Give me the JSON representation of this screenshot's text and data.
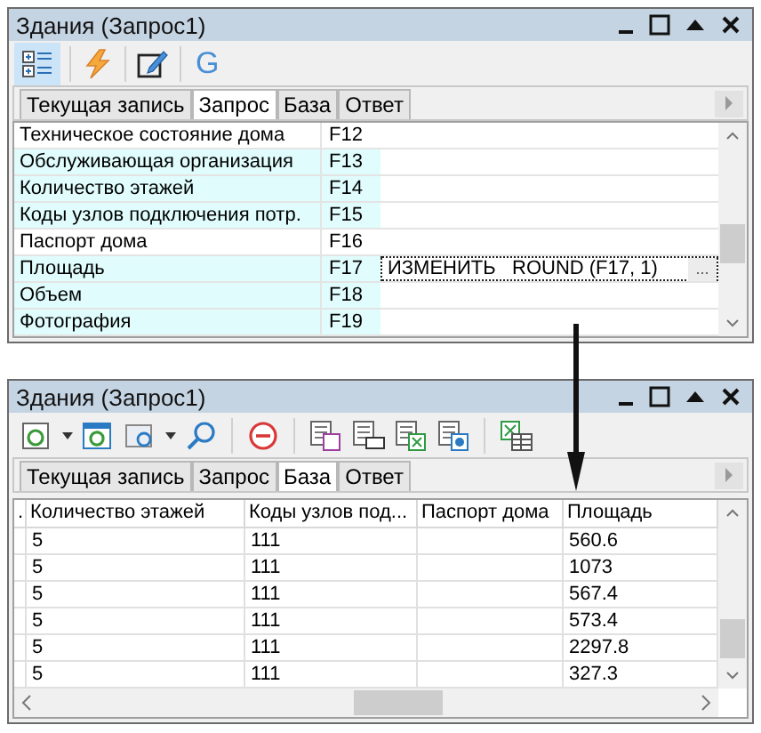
{
  "windows": [
    {
      "title": "Здания (Запрос1)",
      "toolbar": {
        "letter": "G"
      },
      "tabs": [
        {
          "label": "Текущая запись",
          "selected": false
        },
        {
          "label": "Запрос",
          "selected": true
        },
        {
          "label": "База",
          "selected": false
        },
        {
          "label": "Ответ",
          "selected": false
        }
      ],
      "query_rows": [
        {
          "name": "Техническое состояние дома",
          "field": "F12",
          "highlighted": false,
          "editing": false
        },
        {
          "name": "Обслуживающая организация",
          "field": "F13",
          "highlighted": true,
          "editing": false
        },
        {
          "name": "Количество этажей",
          "field": "F14",
          "highlighted": true,
          "editing": false
        },
        {
          "name": "Коды узлов подключения потр.",
          "field": "F15",
          "highlighted": true,
          "editing": false
        },
        {
          "name": "Паспорт дома",
          "field": "F16",
          "highlighted": false,
          "editing": false
        },
        {
          "name": "Площадь",
          "field": "F17",
          "highlighted": true,
          "editing": true,
          "value": "ИЗМЕНИТЬ   ROUND (F17, 1)",
          "button": "..."
        },
        {
          "name": "Объем",
          "field": "F18",
          "highlighted": true,
          "editing": false
        },
        {
          "name": "Фотография",
          "field": "F19",
          "highlighted": true,
          "editing": false
        }
      ]
    },
    {
      "title": "Здания (Запрос1)",
      "tabs": [
        {
          "label": "Текущая запись",
          "selected": false
        },
        {
          "label": "Запрос",
          "selected": false
        },
        {
          "label": "База",
          "selected": true
        },
        {
          "label": "Ответ",
          "selected": false
        }
      ],
      "table": {
        "columns": [
          ".",
          "Количество этажей",
          "Коды узлов под...",
          "Паспорт дома",
          "Площадь"
        ],
        "rows": [
          [
            "",
            "5",
            "111",
            "",
            "560.6"
          ],
          [
            "",
            "5",
            "111",
            "",
            "1073"
          ],
          [
            "",
            "5",
            "111",
            "",
            "567.4"
          ],
          [
            "",
            "5",
            "111",
            "",
            "573.4"
          ],
          [
            "",
            "5",
            "111",
            "",
            "2297.8"
          ],
          [
            "",
            "5",
            "111",
            "",
            "327.3"
          ]
        ]
      }
    }
  ]
}
